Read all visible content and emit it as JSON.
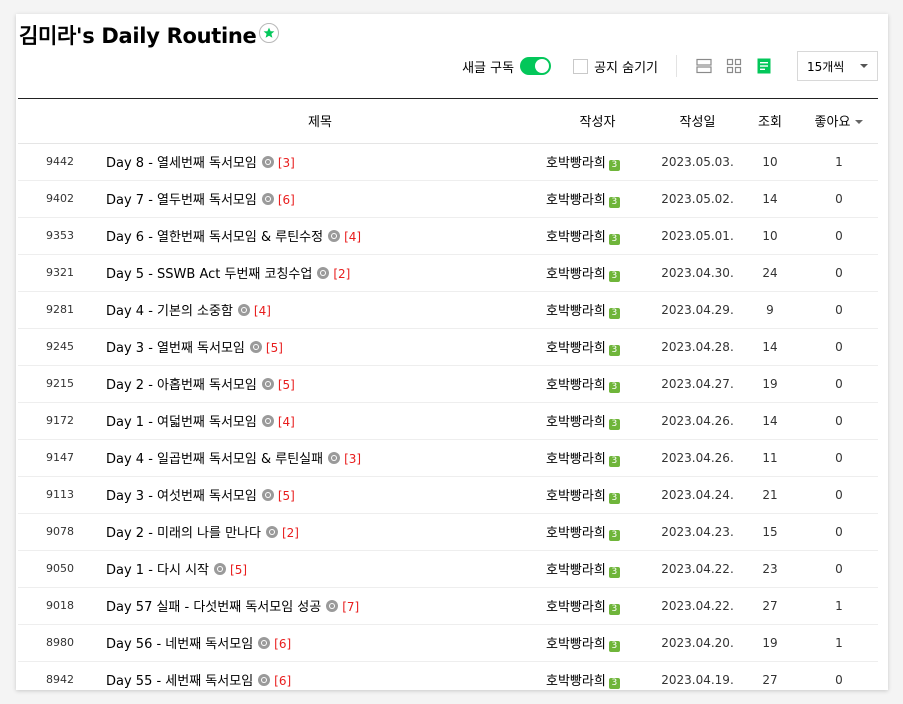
{
  "cafe_title": "김미라's Daily Routine",
  "controls": {
    "subscribe_label": "새글 구독",
    "subscribe_on": true,
    "hide_notice_label": "공지 숨기기",
    "page_size": "15개씩"
  },
  "columns": {
    "title": "제목",
    "author": "작성자",
    "date": "작성일",
    "views": "조회",
    "likes": "좋아요"
  },
  "accent_color": "#03c75a",
  "comment_color": "#e81d1d",
  "posts": [
    {
      "no": "9442",
      "title": "Day 8 - 열세번째 독서모임",
      "comments": "[3]",
      "author": "호박빵라희",
      "level": "3",
      "date": "2023.05.03.",
      "views": "10",
      "likes": "1"
    },
    {
      "no": "9402",
      "title": "Day 7 - 열두번째 독서모임",
      "comments": "[6]",
      "author": "호박빵라희",
      "level": "3",
      "date": "2023.05.02.",
      "views": "14",
      "likes": "0"
    },
    {
      "no": "9353",
      "title": "Day 6 - 열한번째 독서모임 & 루틴수정",
      "comments": "[4]",
      "author": "호박빵라희",
      "level": "3",
      "date": "2023.05.01.",
      "views": "10",
      "likes": "0"
    },
    {
      "no": "9321",
      "title": "Day 5 - SSWB Act 두번째 코칭수업",
      "comments": "[2]",
      "author": "호박빵라희",
      "level": "3",
      "date": "2023.04.30.",
      "views": "24",
      "likes": "0"
    },
    {
      "no": "9281",
      "title": "Day 4 - 기본의 소중함",
      "comments": "[4]",
      "author": "호박빵라희",
      "level": "3",
      "date": "2023.04.29.",
      "views": "9",
      "likes": "0"
    },
    {
      "no": "9245",
      "title": "Day 3 - 열번째 독서모임",
      "comments": "[5]",
      "author": "호박빵라희",
      "level": "3",
      "date": "2023.04.28.",
      "views": "14",
      "likes": "0"
    },
    {
      "no": "9215",
      "title": "Day 2 - 아홉번째 독서모임",
      "comments": "[5]",
      "author": "호박빵라희",
      "level": "3",
      "date": "2023.04.27.",
      "views": "19",
      "likes": "0"
    },
    {
      "no": "9172",
      "title": "Day 1 - 여덟번째 독서모임",
      "comments": "[4]",
      "author": "호박빵라희",
      "level": "3",
      "date": "2023.04.26.",
      "views": "14",
      "likes": "0"
    },
    {
      "no": "9147",
      "title": "Day 4 - 일곱번째 독서모임 & 루틴실패",
      "comments": "[3]",
      "author": "호박빵라희",
      "level": "3",
      "date": "2023.04.26.",
      "views": "11",
      "likes": "0"
    },
    {
      "no": "9113",
      "title": "Day 3 - 여섯번째 독서모임",
      "comments": "[5]",
      "author": "호박빵라희",
      "level": "3",
      "date": "2023.04.24.",
      "views": "21",
      "likes": "0"
    },
    {
      "no": "9078",
      "title": "Day 2 - 미래의 나를 만나다",
      "comments": "[2]",
      "author": "호박빵라희",
      "level": "3",
      "date": "2023.04.23.",
      "views": "15",
      "likes": "0"
    },
    {
      "no": "9050",
      "title": "Day 1 - 다시 시작",
      "comments": "[5]",
      "author": "호박빵라희",
      "level": "3",
      "date": "2023.04.22.",
      "views": "23",
      "likes": "0"
    },
    {
      "no": "9018",
      "title": "Day 57 실패 - 다섯번째 독서모임 성공",
      "comments": "[7]",
      "author": "호박빵라희",
      "level": "3",
      "date": "2023.04.22.",
      "views": "27",
      "likes": "1"
    },
    {
      "no": "8980",
      "title": "Day 56 - 네번째 독서모임",
      "comments": "[6]",
      "author": "호박빵라희",
      "level": "3",
      "date": "2023.04.20.",
      "views": "19",
      "likes": "1"
    },
    {
      "no": "8942",
      "title": "Day 55 - 세번째 독서모임",
      "comments": "[6]",
      "author": "호박빵라희",
      "level": "3",
      "date": "2023.04.19.",
      "views": "27",
      "likes": "0"
    }
  ]
}
